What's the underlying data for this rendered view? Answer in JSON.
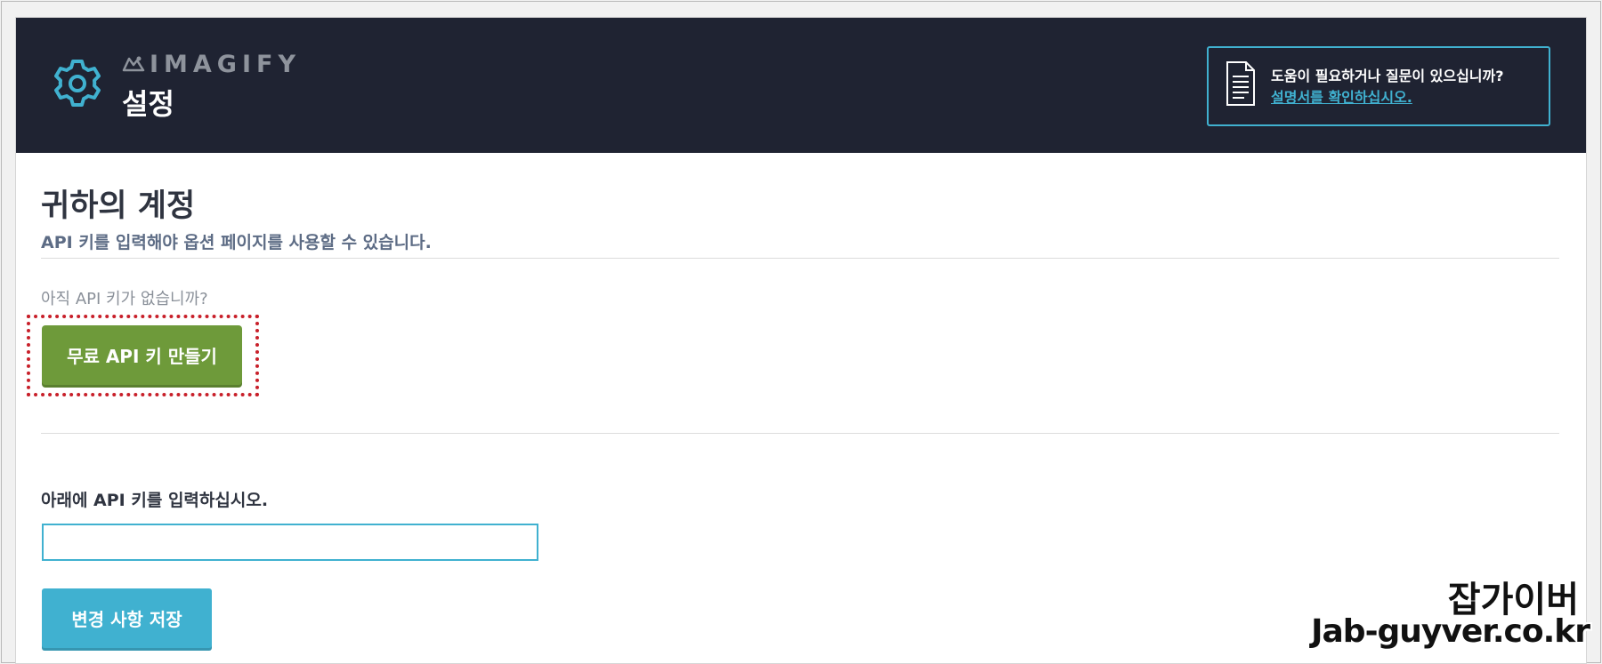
{
  "header": {
    "brand": "IMAGIFY",
    "title": "설정",
    "help": {
      "question": "도움이 필요하거나 질문이 있으십니까?",
      "link_text": "설명서를 확인하십시오."
    }
  },
  "account": {
    "title": "귀하의 계정",
    "subtitle": "API 키를 입력해야 옵션 페이지를 사용할 수 있습니다.",
    "no_key_prompt": "아직 API 키가 없습니까?",
    "create_key_button": "무료 API 키 만들기",
    "enter_key_label": "아래에 API 키를 입력하십시오.",
    "api_key_value": "",
    "save_button": "변경 사항 저장"
  },
  "watermark": {
    "name": "잡가이버",
    "url": "Jab-guyver.co.kr"
  },
  "colors": {
    "header_bg": "#1f2332",
    "accent": "#40b1d0",
    "green": "#6e9a3a",
    "highlight": "#c8202a"
  }
}
